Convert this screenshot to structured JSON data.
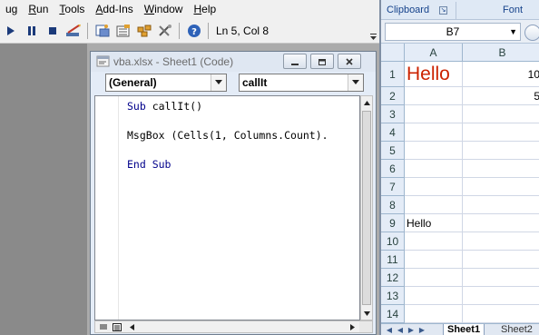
{
  "vbe": {
    "menu": [
      {
        "label": "ug",
        "underline": "",
        "rest": "ug"
      },
      {
        "label": "Run",
        "underline": "R",
        "rest": "un"
      },
      {
        "label": "Tools",
        "underline": "T",
        "rest": "ools"
      },
      {
        "label": "Add-Ins",
        "underline": "A",
        "rest": "dd-Ins"
      },
      {
        "label": "Window",
        "underline": "W",
        "rest": "indow"
      },
      {
        "label": "Help",
        "underline": "H",
        "rest": "elp"
      }
    ],
    "toolbar": {
      "cursor_position": "Ln 5, Col 8",
      "icons": [
        "run-icon",
        "break-icon",
        "reset-icon",
        "design-mode-icon",
        "project-explorer-icon",
        "properties-icon",
        "object-browser-icon",
        "toolbox-icon",
        "help-icon"
      ]
    },
    "code_window": {
      "title": "vba.xlsx - Sheet1 (Code)",
      "object_combo": "(General)",
      "procedure_combo": "callIt",
      "code_lines": {
        "line1_kw": "Sub",
        "line1_rest": " callIt()",
        "line2_kw": "MsgBox",
        "line2_rest": " (Cells(1, Columns.Count).",
        "line3_kw": "End Sub"
      }
    }
  },
  "excel": {
    "ribbon": {
      "clipboard_label": "Clipboard",
      "font_label": "Font"
    },
    "name_box": "B7",
    "columns": [
      "A",
      "B"
    ],
    "rows": [
      "1",
      "2",
      "3",
      "4",
      "5",
      "6",
      "7",
      "8",
      "9",
      "10",
      "11",
      "12",
      "13",
      "14"
    ],
    "cells": {
      "A1": "Hello",
      "B1": "10",
      "B2": "5",
      "A9": "Hello"
    },
    "sheet_tabs": [
      "Sheet1",
      "Sheet2"
    ],
    "colors": {
      "a1_text": "#cc2200",
      "code_keyword": "#00008b"
    }
  }
}
